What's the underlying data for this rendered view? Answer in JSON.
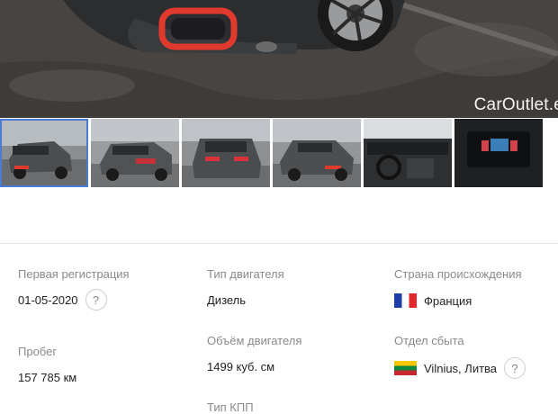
{
  "gallery": {
    "watermark": "CarOutlet.e",
    "thumbnails": [
      {
        "name": "thumbnail-1",
        "active": true
      },
      {
        "name": "thumbnail-2",
        "active": false
      },
      {
        "name": "thumbnail-3",
        "active": false
      },
      {
        "name": "thumbnail-4",
        "active": false
      },
      {
        "name": "thumbnail-5",
        "active": false
      },
      {
        "name": "thumbnail-6",
        "active": false
      }
    ]
  },
  "specs": {
    "first_registration": {
      "label": "Первая регистрация",
      "value": "01-05-2020",
      "help": "?"
    },
    "mileage": {
      "label": "Пробег",
      "value": "157 785 км"
    },
    "engine_type": {
      "label": "Тип двигателя",
      "value": "Дизель"
    },
    "engine_volume": {
      "label": "Объём двигателя",
      "value": "1499 куб. см"
    },
    "transmission": {
      "label": "Тип КПП"
    },
    "origin_country": {
      "label": "Страна происхождения",
      "value": "Франция",
      "flag": "flag-france-icon"
    },
    "sales_department": {
      "label": "Отдел сбыта",
      "value": "Vilnius, Литва",
      "flag": "flag-lithuania-icon",
      "help": "?"
    }
  },
  "colors": {
    "accent": "#4a7bd6",
    "car_body": "#4b4d4f",
    "trim_red": "#e03a2c"
  }
}
